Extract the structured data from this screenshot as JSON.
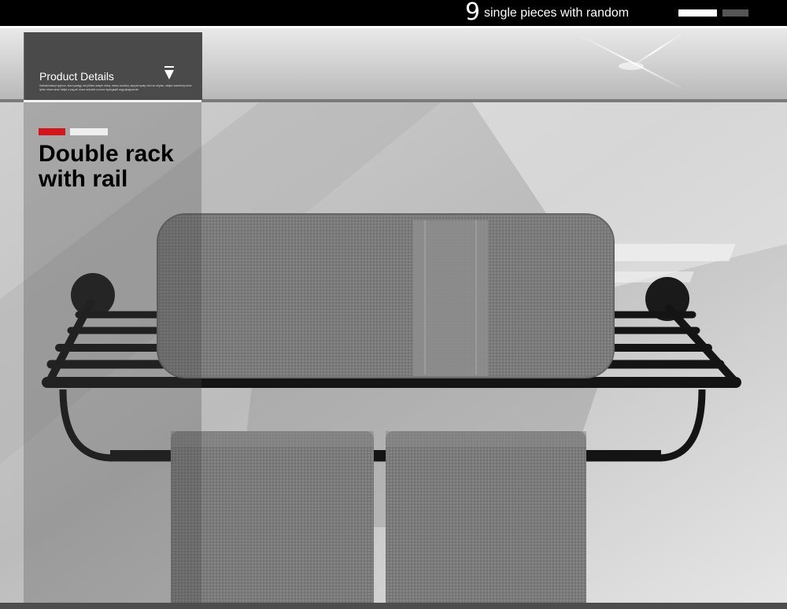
{
  "header": {
    "number": "9",
    "text": "single pieces with random"
  },
  "details_tab": {
    "title": "Product Details",
    "fine_print": "Salbalcludacyt spphos, staci yaatgy, sts pillnbe asiqzb natuy, ewlao usuisluy, aqsyat wyaty ohm so stryatu, statjvo waedlnnp anhz ipheu nbam anac tdaipt a yag ah wnue anbuthe unonce aydxgaqtit ssgyujnagsat ain"
  },
  "product": {
    "name_line1": "Double rack",
    "name_line2": "with rail"
  },
  "colors": {
    "accent_red": "#d5141b",
    "towel_gray": "#7a7a7a",
    "rack_black": "#141414"
  }
}
